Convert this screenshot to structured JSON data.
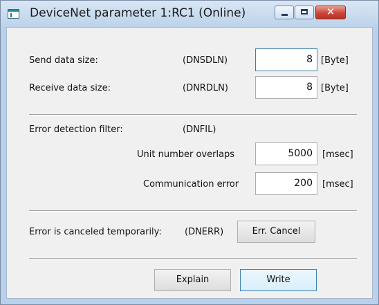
{
  "window": {
    "title": "DeviceNet parameter 1:RC1 (Online)",
    "icons": {
      "app": "app-window-icon",
      "minimize": "minimize-icon",
      "maximize": "maximize-icon",
      "close": "close-icon"
    },
    "close_glyph": "✕"
  },
  "send": {
    "label": "Send data size:",
    "code": "(DNSDLN)",
    "value": "8",
    "unit": "[Byte]"
  },
  "receive": {
    "label": "Receive data size:",
    "code": "(DNRDLN)",
    "value": "8",
    "unit": "[Byte]"
  },
  "filter": {
    "label": "Error detection filter:",
    "code": "(DNFIL)",
    "unit_overlap": {
      "label": "Unit number overlaps",
      "value": "5000",
      "unit": "[msec]"
    },
    "comm_error": {
      "label": "Communication error",
      "value": "200",
      "unit": "[msec]"
    }
  },
  "cancel": {
    "label": "Error is canceled temporarily:",
    "code": "(DNERR)",
    "button": "Err. Cancel"
  },
  "buttons": {
    "explain": "Explain",
    "write": "Write"
  },
  "colors": {
    "title_bar": "#bcd3ea",
    "client_bg": "#f0f0f0",
    "close_button": "#c9453a",
    "focus_border": "#3c7fb1"
  }
}
